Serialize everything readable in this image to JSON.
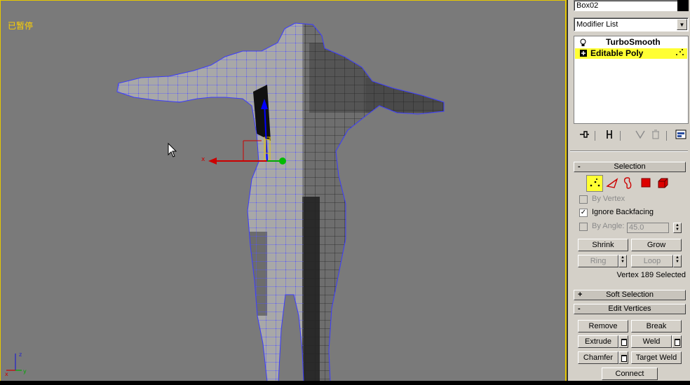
{
  "viewport": {
    "label": "已暂停"
  },
  "panel": {
    "object_name": "Box02",
    "object_color": "#000000",
    "modifier_list_label": "Modifier List",
    "stack": [
      {
        "label": "TurboSmooth",
        "icon": "lightbulb-icon"
      },
      {
        "label": "Editable Poly",
        "icon": "expand-plus-icon",
        "selected": true
      }
    ],
    "selection_rollout": {
      "title": "Selection",
      "by_vertex_label": "By Vertex",
      "ignore_backfacing_label": "Ignore Backfacing",
      "ignore_backfacing_checked": true,
      "by_angle_label": "By Angle:",
      "by_angle_value": "45.0",
      "shrink_label": "Shrink",
      "grow_label": "Grow",
      "ring_label": "Ring",
      "loop_label": "Loop",
      "status": "Vertex 189 Selected"
    },
    "soft_selection_rollout": {
      "title": "Soft Selection"
    },
    "edit_vertices_rollout": {
      "title": "Edit Vertices",
      "remove_label": "Remove",
      "break_label": "Break",
      "extrude_label": "Extrude",
      "weld_label": "Weld",
      "chamfer_label": "Chamfer",
      "target_weld_label": "Target Weld",
      "connect_label": "Connect"
    },
    "rollout_sign_collapse": "-",
    "rollout_sign_expand": "+"
  },
  "colors": {
    "viewport_bg": "#7a7a7a",
    "active_border": "#e6c800",
    "selection_highlight": "#ffff33",
    "wire_selected": "#3c3cff",
    "panel_bg": "#d4d0c8"
  }
}
